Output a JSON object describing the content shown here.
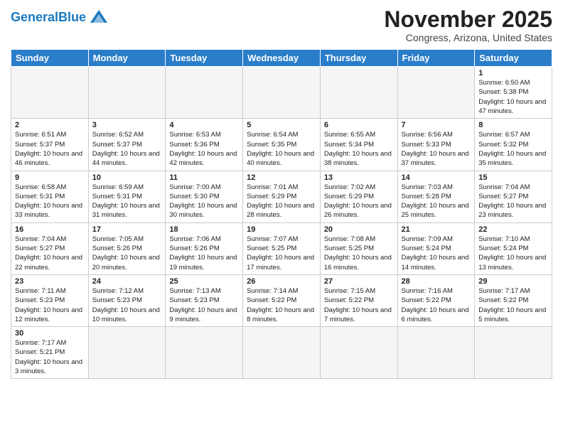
{
  "header": {
    "logo_general": "General",
    "logo_blue": "Blue",
    "month_title": "November 2025",
    "location": "Congress, Arizona, United States"
  },
  "weekdays": [
    "Sunday",
    "Monday",
    "Tuesday",
    "Wednesday",
    "Thursday",
    "Friday",
    "Saturday"
  ],
  "weeks": [
    [
      {
        "day": "",
        "info": ""
      },
      {
        "day": "",
        "info": ""
      },
      {
        "day": "",
        "info": ""
      },
      {
        "day": "",
        "info": ""
      },
      {
        "day": "",
        "info": ""
      },
      {
        "day": "",
        "info": ""
      },
      {
        "day": "1",
        "info": "Sunrise: 6:50 AM\nSunset: 5:38 PM\nDaylight: 10 hours and 47 minutes."
      }
    ],
    [
      {
        "day": "2",
        "info": "Sunrise: 6:51 AM\nSunset: 5:37 PM\nDaylight: 10 hours and 46 minutes."
      },
      {
        "day": "3",
        "info": "Sunrise: 6:52 AM\nSunset: 5:37 PM\nDaylight: 10 hours and 44 minutes."
      },
      {
        "day": "4",
        "info": "Sunrise: 6:53 AM\nSunset: 5:36 PM\nDaylight: 10 hours and 42 minutes."
      },
      {
        "day": "5",
        "info": "Sunrise: 6:54 AM\nSunset: 5:35 PM\nDaylight: 10 hours and 40 minutes."
      },
      {
        "day": "6",
        "info": "Sunrise: 6:55 AM\nSunset: 5:34 PM\nDaylight: 10 hours and 38 minutes."
      },
      {
        "day": "7",
        "info": "Sunrise: 6:56 AM\nSunset: 5:33 PM\nDaylight: 10 hours and 37 minutes."
      },
      {
        "day": "8",
        "info": "Sunrise: 6:57 AM\nSunset: 5:32 PM\nDaylight: 10 hours and 35 minutes."
      }
    ],
    [
      {
        "day": "9",
        "info": "Sunrise: 6:58 AM\nSunset: 5:31 PM\nDaylight: 10 hours and 33 minutes."
      },
      {
        "day": "10",
        "info": "Sunrise: 6:59 AM\nSunset: 5:31 PM\nDaylight: 10 hours and 31 minutes."
      },
      {
        "day": "11",
        "info": "Sunrise: 7:00 AM\nSunset: 5:30 PM\nDaylight: 10 hours and 30 minutes."
      },
      {
        "day": "12",
        "info": "Sunrise: 7:01 AM\nSunset: 5:29 PM\nDaylight: 10 hours and 28 minutes."
      },
      {
        "day": "13",
        "info": "Sunrise: 7:02 AM\nSunset: 5:29 PM\nDaylight: 10 hours and 26 minutes."
      },
      {
        "day": "14",
        "info": "Sunrise: 7:03 AM\nSunset: 5:28 PM\nDaylight: 10 hours and 25 minutes."
      },
      {
        "day": "15",
        "info": "Sunrise: 7:04 AM\nSunset: 5:27 PM\nDaylight: 10 hours and 23 minutes."
      }
    ],
    [
      {
        "day": "16",
        "info": "Sunrise: 7:04 AM\nSunset: 5:27 PM\nDaylight: 10 hours and 22 minutes."
      },
      {
        "day": "17",
        "info": "Sunrise: 7:05 AM\nSunset: 5:26 PM\nDaylight: 10 hours and 20 minutes."
      },
      {
        "day": "18",
        "info": "Sunrise: 7:06 AM\nSunset: 5:26 PM\nDaylight: 10 hours and 19 minutes."
      },
      {
        "day": "19",
        "info": "Sunrise: 7:07 AM\nSunset: 5:25 PM\nDaylight: 10 hours and 17 minutes."
      },
      {
        "day": "20",
        "info": "Sunrise: 7:08 AM\nSunset: 5:25 PM\nDaylight: 10 hours and 16 minutes."
      },
      {
        "day": "21",
        "info": "Sunrise: 7:09 AM\nSunset: 5:24 PM\nDaylight: 10 hours and 14 minutes."
      },
      {
        "day": "22",
        "info": "Sunrise: 7:10 AM\nSunset: 5:24 PM\nDaylight: 10 hours and 13 minutes."
      }
    ],
    [
      {
        "day": "23",
        "info": "Sunrise: 7:11 AM\nSunset: 5:23 PM\nDaylight: 10 hours and 12 minutes."
      },
      {
        "day": "24",
        "info": "Sunrise: 7:12 AM\nSunset: 5:23 PM\nDaylight: 10 hours and 10 minutes."
      },
      {
        "day": "25",
        "info": "Sunrise: 7:13 AM\nSunset: 5:23 PM\nDaylight: 10 hours and 9 minutes."
      },
      {
        "day": "26",
        "info": "Sunrise: 7:14 AM\nSunset: 5:22 PM\nDaylight: 10 hours and 8 minutes."
      },
      {
        "day": "27",
        "info": "Sunrise: 7:15 AM\nSunset: 5:22 PM\nDaylight: 10 hours and 7 minutes."
      },
      {
        "day": "28",
        "info": "Sunrise: 7:16 AM\nSunset: 5:22 PM\nDaylight: 10 hours and 6 minutes."
      },
      {
        "day": "29",
        "info": "Sunrise: 7:17 AM\nSunset: 5:22 PM\nDaylight: 10 hours and 5 minutes."
      }
    ],
    [
      {
        "day": "30",
        "info": "Sunrise: 7:17 AM\nSunset: 5:21 PM\nDaylight: 10 hours and 3 minutes."
      },
      {
        "day": "",
        "info": ""
      },
      {
        "day": "",
        "info": ""
      },
      {
        "day": "",
        "info": ""
      },
      {
        "day": "",
        "info": ""
      },
      {
        "day": "",
        "info": ""
      },
      {
        "day": "",
        "info": ""
      }
    ]
  ]
}
